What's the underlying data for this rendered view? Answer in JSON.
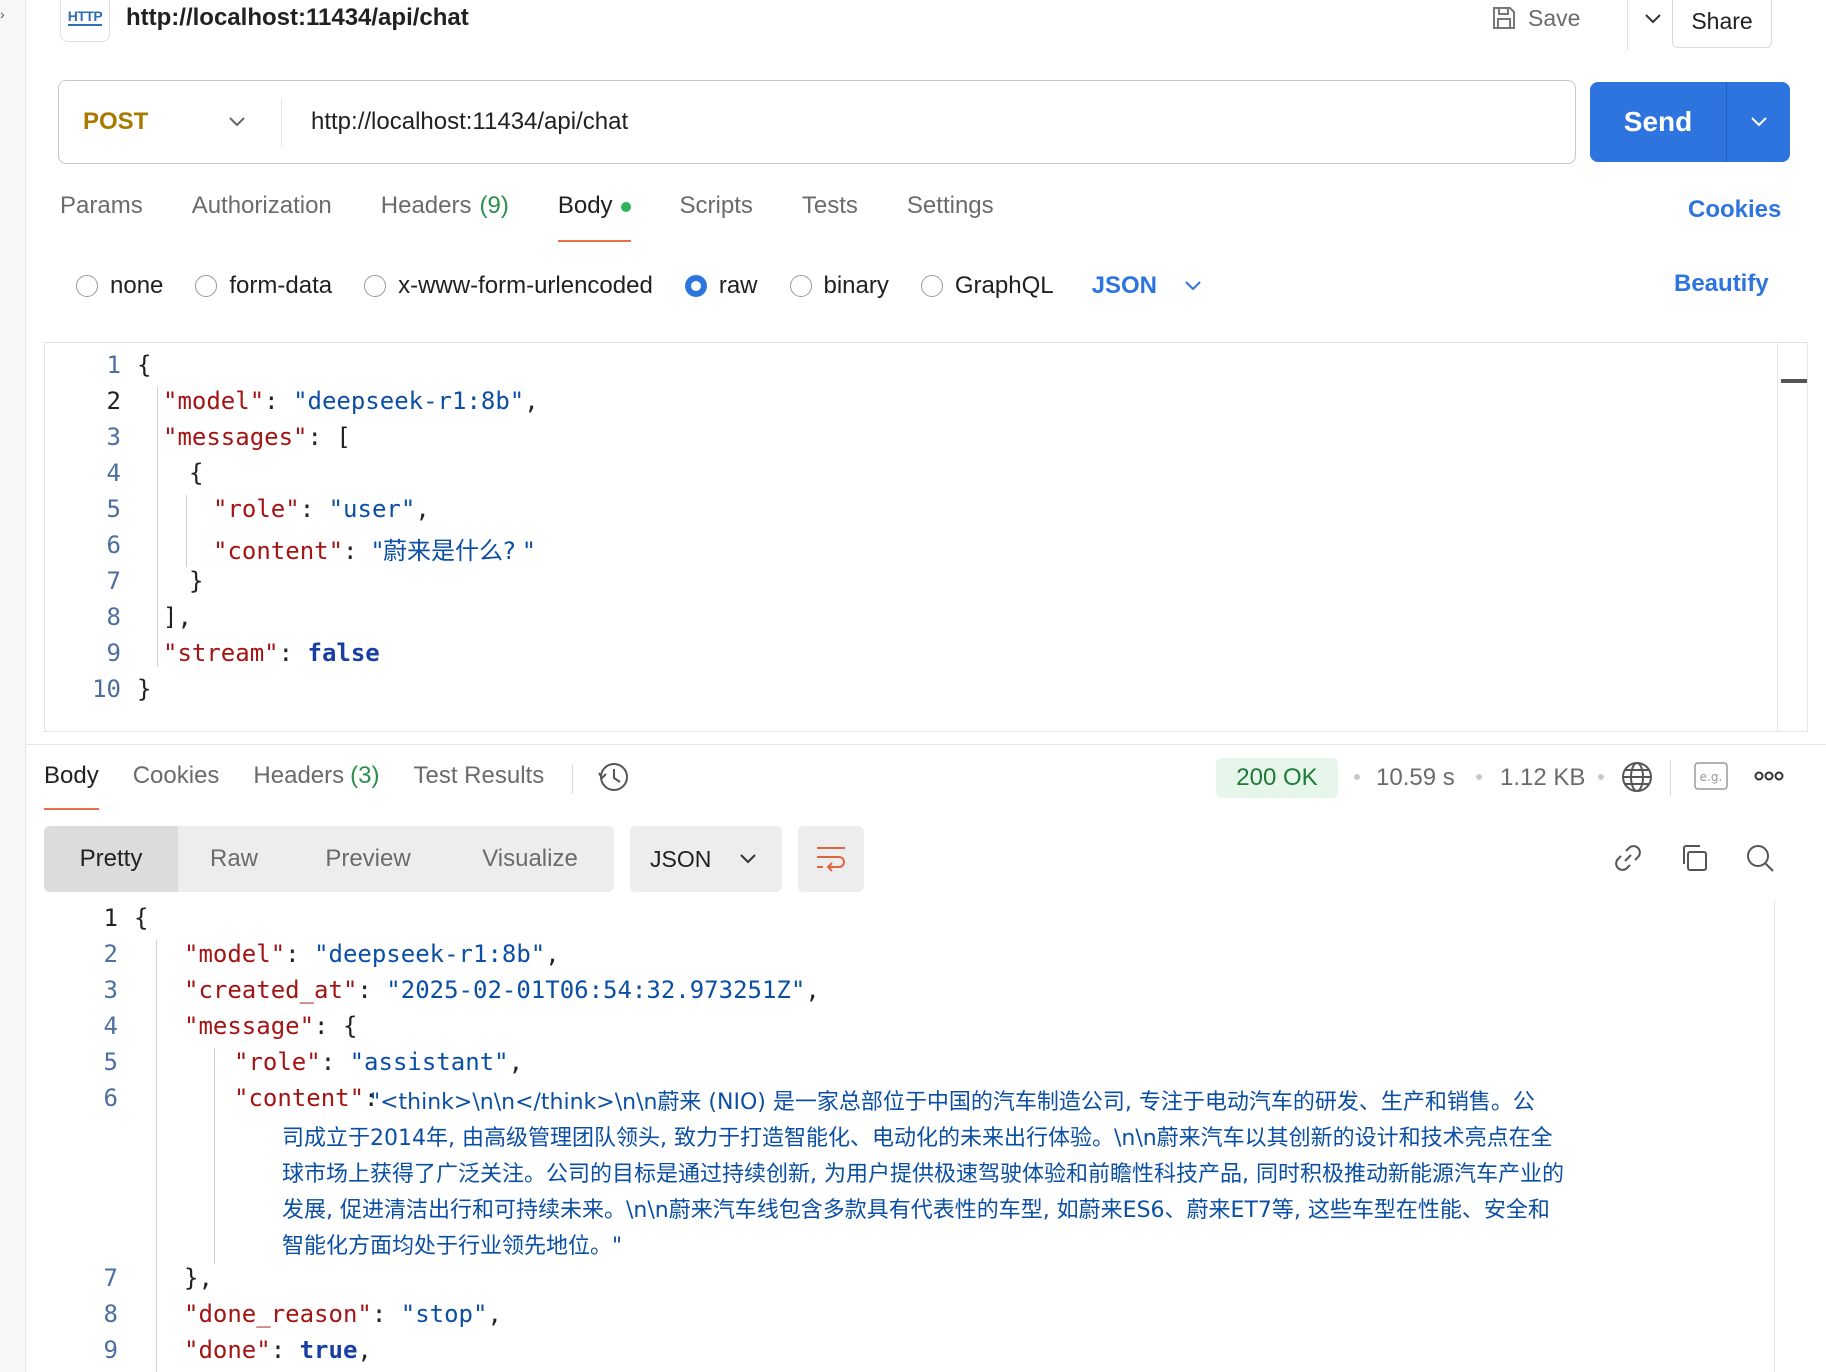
{
  "request": {
    "title": "http://localhost:11434/api/chat",
    "badge": "HTTP",
    "save_label": "Save",
    "share_label": "Share",
    "method": "POST",
    "url": "http://localhost:11434/api/chat",
    "send_label": "Send"
  },
  "request_tabs": {
    "params": "Params",
    "authorization": "Authorization",
    "headers": "Headers",
    "headers_count": "(9)",
    "body": "Body",
    "scripts": "Scripts",
    "tests": "Tests",
    "settings": "Settings",
    "cookies": "Cookies"
  },
  "body_types": {
    "none": "none",
    "form_data": "form-data",
    "urlencoded": "x-www-form-urlencoded",
    "raw": "raw",
    "binary": "binary",
    "graphql": "GraphQL",
    "selected": "raw",
    "language": "JSON",
    "beautify": "Beautify"
  },
  "request_body": {
    "line_numbers": [
      "1",
      "2",
      "3",
      "4",
      "5",
      "6",
      "7",
      "8",
      "9",
      "10"
    ],
    "open_brace": "{",
    "model_key": "\"model\"",
    "model_val": "\"deepseek-r1:8b\"",
    "messages_key": "\"messages\"",
    "role_key": "\"role\"",
    "role_val": "\"user\"",
    "content_key": "\"content\"",
    "content_val": "\"蔚来是什么? \"",
    "stream_key": "\"stream\"",
    "stream_val": "false"
  },
  "response_tabs": {
    "body": "Body",
    "cookies": "Cookies",
    "headers": "Headers",
    "headers_count": "(3)",
    "test_results": "Test Results"
  },
  "response_meta": {
    "status": "200 OK",
    "time": "10.59 s",
    "size": "1.12 KB",
    "example_label": "e.g."
  },
  "response_toolbar": {
    "pretty": "Pretty",
    "raw": "Raw",
    "preview": "Preview",
    "visualize": "Visualize",
    "format": "JSON"
  },
  "response_body": {
    "line_numbers": [
      "1",
      "2",
      "3",
      "4",
      "5",
      "6",
      "7",
      "8",
      "9"
    ],
    "model_key": "\"model\"",
    "model_val": "\"deepseek-r1:8b\"",
    "created_key": "\"created_at\"",
    "created_val": "\"2025-02-01T06:54:32.973251Z\"",
    "message_key": "\"message\"",
    "role_key": "\"role\"",
    "role_val": "\"assistant\"",
    "content_key": "\"content\"",
    "content_lines": [
      "\"<think>\\n\\n</think>\\n\\n蔚来 (NIO) 是一家总部位于中国的汽车制造公司, 专注于电动汽车的研发、生产和销售。公",
      "司成立于2014年, 由高级管理团队领头, 致力于打造智能化、电动化的未来出行体验。\\n\\n蔚来汽车以其创新的设计和技术亮点在全",
      "球市场上获得了广泛关注。公司的目标是通过持续创新, 为用户提供极速驾驶体验和前瞻性科技产品, 同时积极推动新能源汽车产业的",
      "发展, 促进清洁出行和可持续未来。\\n\\n蔚来汽车线包含多款具有代表性的车型, 如蔚来ES6、蔚来ET7等, 这些车型在性能、安全和",
      "智能化方面均处于行业领先地位。\""
    ],
    "done_reason_key": "\"done_reason\"",
    "done_reason_val": "\"stop\"",
    "done_key": "\"done\"",
    "done_val": "true"
  },
  "colors": {
    "accent": "#2e74de",
    "method": "#a87b00",
    "tab_underline": "#ef6c4a",
    "status_ok": "#1f7a3a"
  }
}
